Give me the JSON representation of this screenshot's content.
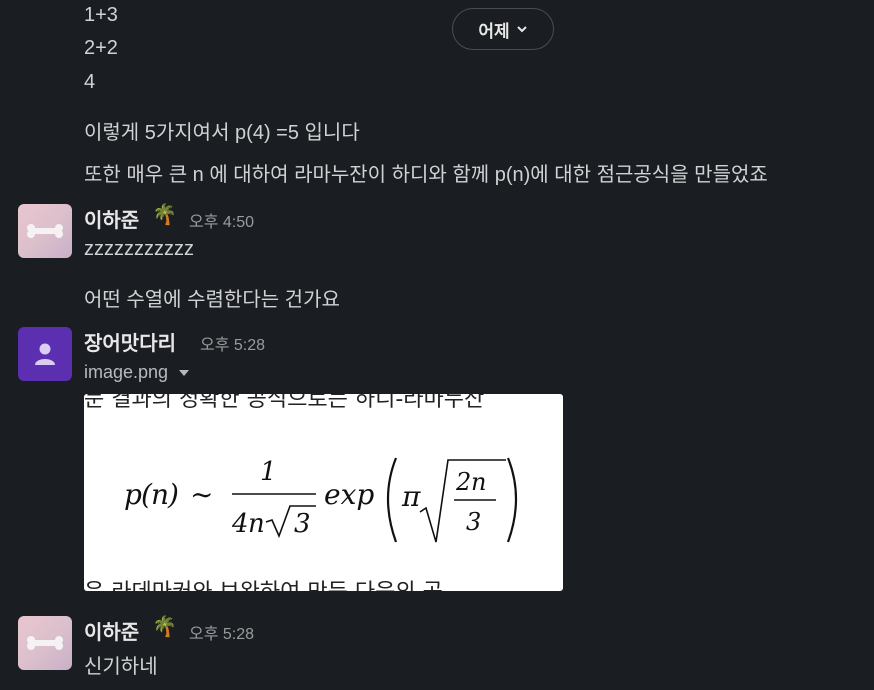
{
  "top_lines": [
    "1+3",
    "2+2",
    "4"
  ],
  "day_divider": {
    "label": "어제"
  },
  "messages_prev": [
    "이렇게 5가지여서 p(4) =5 입니다",
    "또한 매우 큰 n 에 대하여 라마누잔이 하디와 함께 p(n)에 대한 점근공식을 만들었죠"
  ],
  "msg1": {
    "author": "이하준",
    "emoji": "🌴",
    "time": "오후 4:50",
    "lines": [
      "zzzzzzzzzzz",
      "어떤 수열에 수렴한다는 건가요"
    ]
  },
  "msg2": {
    "author": "장어맛다리",
    "time": "오후 5:28",
    "file_name": "image.png",
    "image": {
      "top_clip": "문 결과의 정확한 공식으로는 하디-라마누잔",
      "bottom_clip": "은 라데마커와 보완하여 만든 다음의 공"
    }
  },
  "msg3": {
    "author": "이하준",
    "emoji": "🌴",
    "time": "오후 5:28",
    "lines": [
      "신기하네"
    ]
  },
  "colors": {
    "background": "#1a1d21",
    "text": "#d1d2d3",
    "avatar_purple": "#5b2fb0"
  }
}
